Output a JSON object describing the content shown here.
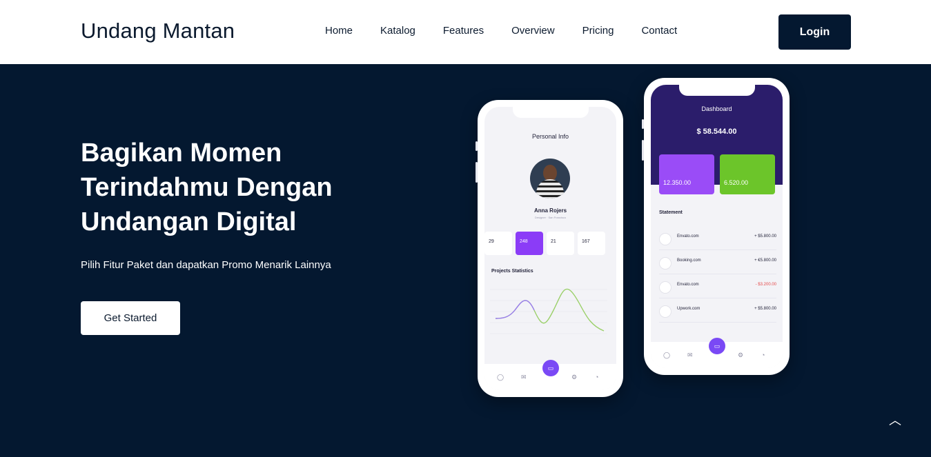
{
  "brand": "Undang Mantan",
  "nav": {
    "items": [
      "Home",
      "Katalog",
      "Features",
      "Overview",
      "Pricing",
      "Contact"
    ],
    "login_label": "Login"
  },
  "hero": {
    "headline": "Bagikan Momen Terindahmu Dengan Undangan Digital",
    "subtext": "Pilih Fitur Paket dan dapatkan Promo Menarik Lainnya",
    "cta_label": "Get Started"
  },
  "phone_left": {
    "title": "Personal Info",
    "name": "Anna Rojers",
    "role": "Designer · San Francisco",
    "stats": [
      {
        "value": "29",
        "active": false
      },
      {
        "value": "248",
        "active": true
      },
      {
        "value": "21",
        "active": false
      },
      {
        "value": "167",
        "active": false
      }
    ],
    "chart_title": "Projects Statistics"
  },
  "phone_right": {
    "title": "Dashboard",
    "balance": "$ 58.544.00",
    "card_purple": "12.350.00",
    "card_green": "6.520.00",
    "statement_title": "Statement",
    "rows": [
      {
        "name": "Envato.com",
        "amount": "+ $5.800.00",
        "negative": false
      },
      {
        "name": "Booking.com",
        "amount": "+ €5.800.00",
        "negative": false
      },
      {
        "name": "Envato.com",
        "amount": "- $3.200.00",
        "negative": true
      },
      {
        "name": "Upwork.com",
        "amount": "+ $5.800.00",
        "negative": false
      }
    ]
  },
  "colors": {
    "primary": "#041830",
    "purple": "#8b3cf7",
    "green": "#6cc52a"
  }
}
